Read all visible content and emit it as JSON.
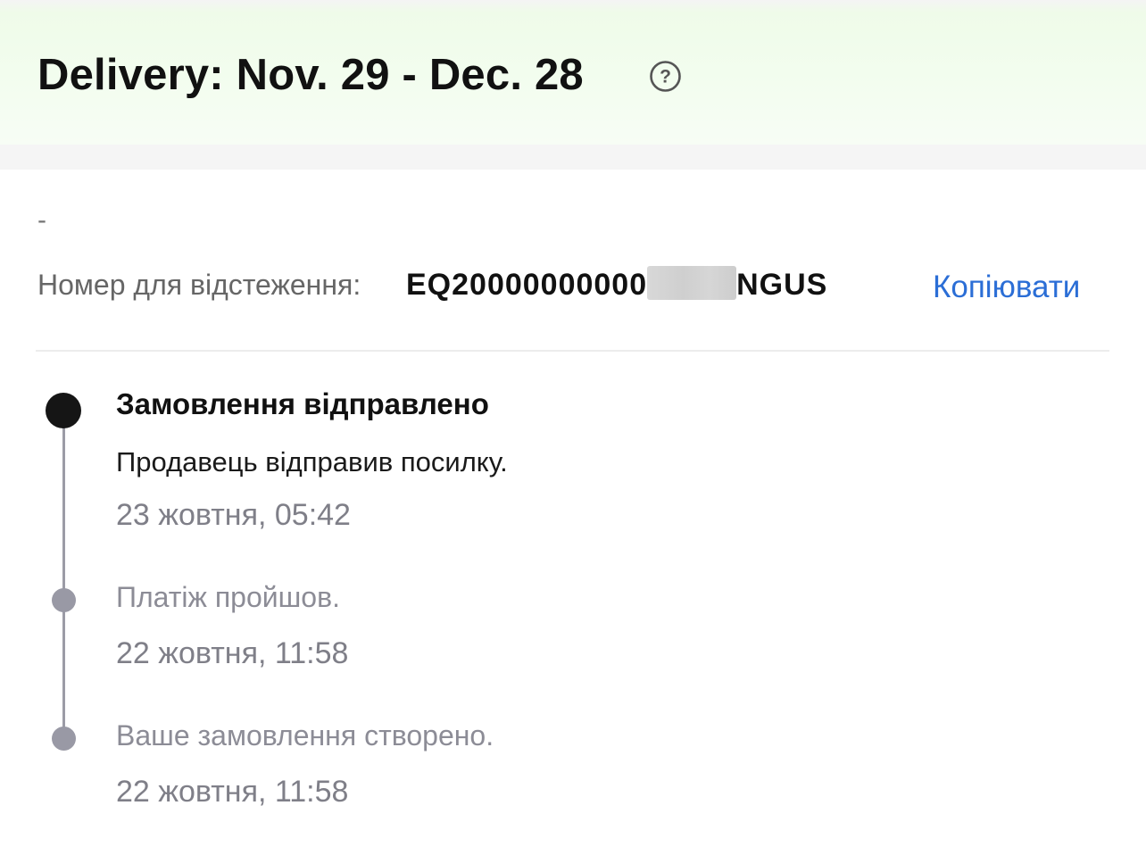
{
  "header": {
    "title": "Delivery: Nov. 29 - Dec. 28",
    "help_icon": "question-circle-icon"
  },
  "shipment": {
    "dash": "-",
    "tracking_label": "Номер для відстеження: ",
    "tracking_prefix": "EQ20000000000",
    "tracking_suffix": "NGUS",
    "copy_label": "Копіювати"
  },
  "timeline": {
    "events": [
      {
        "title": "Замовлення відправлено",
        "description": "Продавець відправив посилку.",
        "time": "23 жовтня, 05:42"
      },
      {
        "description": "Платіж пройшов.",
        "time": "22 жовтня, 11:58"
      },
      {
        "description": "Ваше замовлення створено.",
        "time": "22 жовтня, 11:58"
      }
    ]
  },
  "colors": {
    "accent_link": "#2b6ed6",
    "header_bg": "#f2fdee",
    "timeline_active": "#151515",
    "timeline_inactive": "#9999a5"
  }
}
